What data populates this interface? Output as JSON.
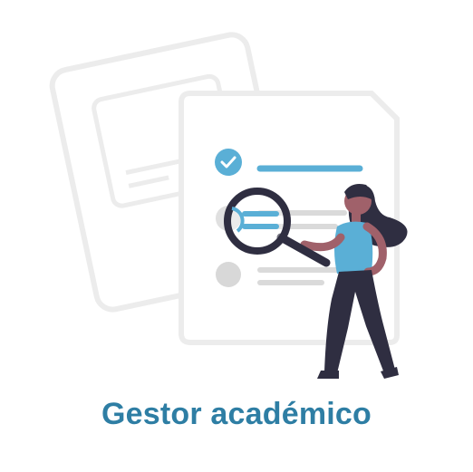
{
  "caption": "Gestor académico",
  "colors": {
    "accent": "#2e7ea4",
    "checklist_blue": "#5aafd6",
    "paper_outline": "#ececec",
    "skin": "#a0616a",
    "hair": "#2f2e41",
    "pants": "#2f2e41",
    "shirt": "#5aafd6"
  },
  "icons": [
    "check-circle-icon",
    "magnifier-icon"
  ]
}
